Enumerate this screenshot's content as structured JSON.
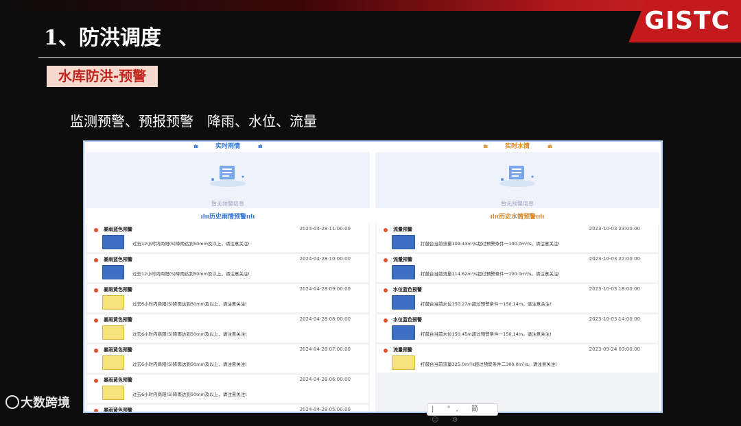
{
  "slide": {
    "brand": "GISTC",
    "title": "1、防洪调度",
    "tag": "水库防洪-预警",
    "subtitle": "监测预警、预报预警　降雨、水位、流量"
  },
  "left": {
    "realtime_title": "实时雨情",
    "empty_text": "暂无预警信息",
    "history_title": "历史雨情预警",
    "items": [
      {
        "name": "暴雨蓝色预警",
        "time": "2024-04-28 11:00:00",
        "msg": "过去12小时内商阳(S)降雨达到50mm及以上，请注意关注!",
        "level": "blue"
      },
      {
        "name": "暴雨蓝色预警",
        "time": "2024-04-28 10:00:00",
        "msg": "过去12小时内商阳(S)降雨达到50mm及以上，请注意关注!",
        "level": "blue"
      },
      {
        "name": "暴雨黄色预警",
        "time": "2024-04-28 09:00:00",
        "msg": "过去6小时内商阳(S)降雨达到50mm及以上，请注意关注!",
        "level": "yellow"
      },
      {
        "name": "暴雨黄色预警",
        "time": "2024-04-28 08:00:00",
        "msg": "过去6小时内商阳(S)降雨达到50mm及以上，请注意关注!",
        "level": "yellow"
      },
      {
        "name": "暴雨黄色预警",
        "time": "2024-04-28 07:00:00",
        "msg": "过去6小时内商阳(S)降雨达到50mm及以上，请注意关注!",
        "level": "yellow"
      },
      {
        "name": "暴雨黄色预警",
        "time": "2024-04-28 06:00:00",
        "msg": "过去6小时内商阳(S)降雨达到50mm及以上，请注意关注!",
        "level": "yellow"
      },
      {
        "name": "暴雨黄色预警",
        "time": "2024-04-28 05:00:00",
        "msg": "",
        "level": "yellow"
      }
    ]
  },
  "right": {
    "realtime_title": "实时水情",
    "empty_text": "暂无预警信息",
    "history_title": "历史水情预警",
    "items": [
      {
        "name": "流量预警",
        "time": "2023-10-03 23:00:00",
        "msg": "打鼓台当前流量109.43m³/s超过预警条件一100.0m³/s。请注意关注!",
        "level": "blue"
      },
      {
        "name": "流量预警",
        "time": "2023-10-03 22:00:00",
        "msg": "打鼓台当前流量114.62m³/s超过预警条件一100.0m³/s。请注意关注!",
        "level": "blue"
      },
      {
        "name": "水位蓝色预警",
        "time": "2023-10-03 18:00:00",
        "msg": "打鼓台当前水位150.27m超过预警条件一150.14m。请注意关注!",
        "level": "blue"
      },
      {
        "name": "水位蓝色预警",
        "time": "2023-10-03 14:00:00",
        "msg": "打鼓台当前水位150.45m超过预警条件一150.14m。请注意关注!",
        "level": "blue"
      },
      {
        "name": "流量预警",
        "time": "2023-09-24 03:00:00",
        "msg": "打鼓台当前流量325.0m³/s超过预警条件二300.0m³/s。请注意关注!",
        "level": "yellow"
      }
    ]
  },
  "toolbar": {
    "label": "| °, 简 ☺ ⚙"
  },
  "watermark": {
    "text": "大数跨境"
  },
  "colors": {
    "brand_red": "#c41a1e",
    "blue_title": "#3a78d8",
    "orange_title": "#d9872a",
    "alert_dot": "#e5502c"
  }
}
